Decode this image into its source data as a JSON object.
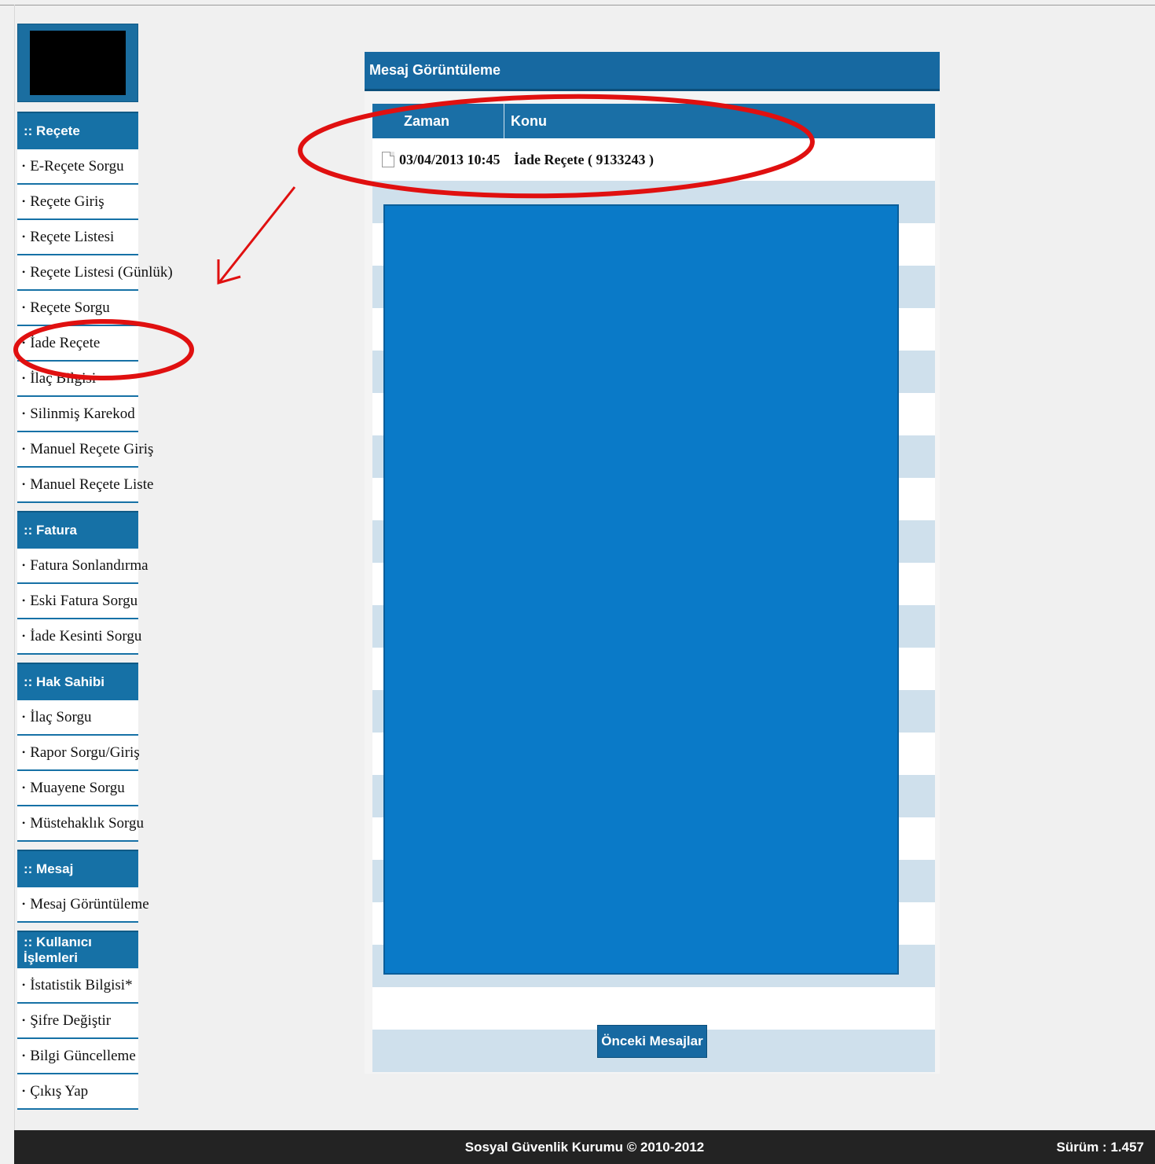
{
  "sidebar": {
    "sections": [
      {
        "title": ":: Reçete",
        "items": [
          "E-Reçete Sorgu",
          "Reçete Giriş",
          "Reçete Listesi",
          "Reçete Listesi (Günlük)",
          "Reçete Sorgu",
          "İade Reçete",
          "İlaç Bilgisi",
          "Silinmiş Karekod",
          "Manuel Reçete Giriş",
          "Manuel Reçete Liste"
        ]
      },
      {
        "title": ":: Fatura",
        "items": [
          "Fatura Sonlandırma",
          "Eski Fatura Sorgu",
          "İade Kesinti Sorgu"
        ]
      },
      {
        "title": ":: Hak Sahibi",
        "items": [
          "İlaç Sorgu",
          "Rapor Sorgu/Giriş",
          "Muayene Sorgu",
          "Müstehaklık Sorgu"
        ]
      },
      {
        "title": ":: Mesaj",
        "items": [
          "Mesaj Görüntüleme"
        ]
      },
      {
        "title": ":: Kullanıcı İşlemleri",
        "items": [
          "İstatistik Bilgisi*",
          "Şifre Değiştir",
          "Bilgi Güncelleme",
          "Çıkış Yap"
        ]
      }
    ]
  },
  "panel": {
    "title": "Mesaj Görüntüleme",
    "columns": {
      "time": "Zaman",
      "topic": "Konu"
    },
    "rows": [
      {
        "time": "03/04/2013 10:45",
        "topic": "İade Reçete ( 9133243 )"
      }
    ],
    "prev_button": "Önceki Mesajlar"
  },
  "footer": {
    "copyright": "Sosyal Güvenlik Kurumu © 2010-2012",
    "version": "Sürüm : 1.457"
  },
  "colors": {
    "header_blue": "#1769a1",
    "redaction_blue": "#0a7ac8",
    "annotation_red": "#e01010"
  }
}
